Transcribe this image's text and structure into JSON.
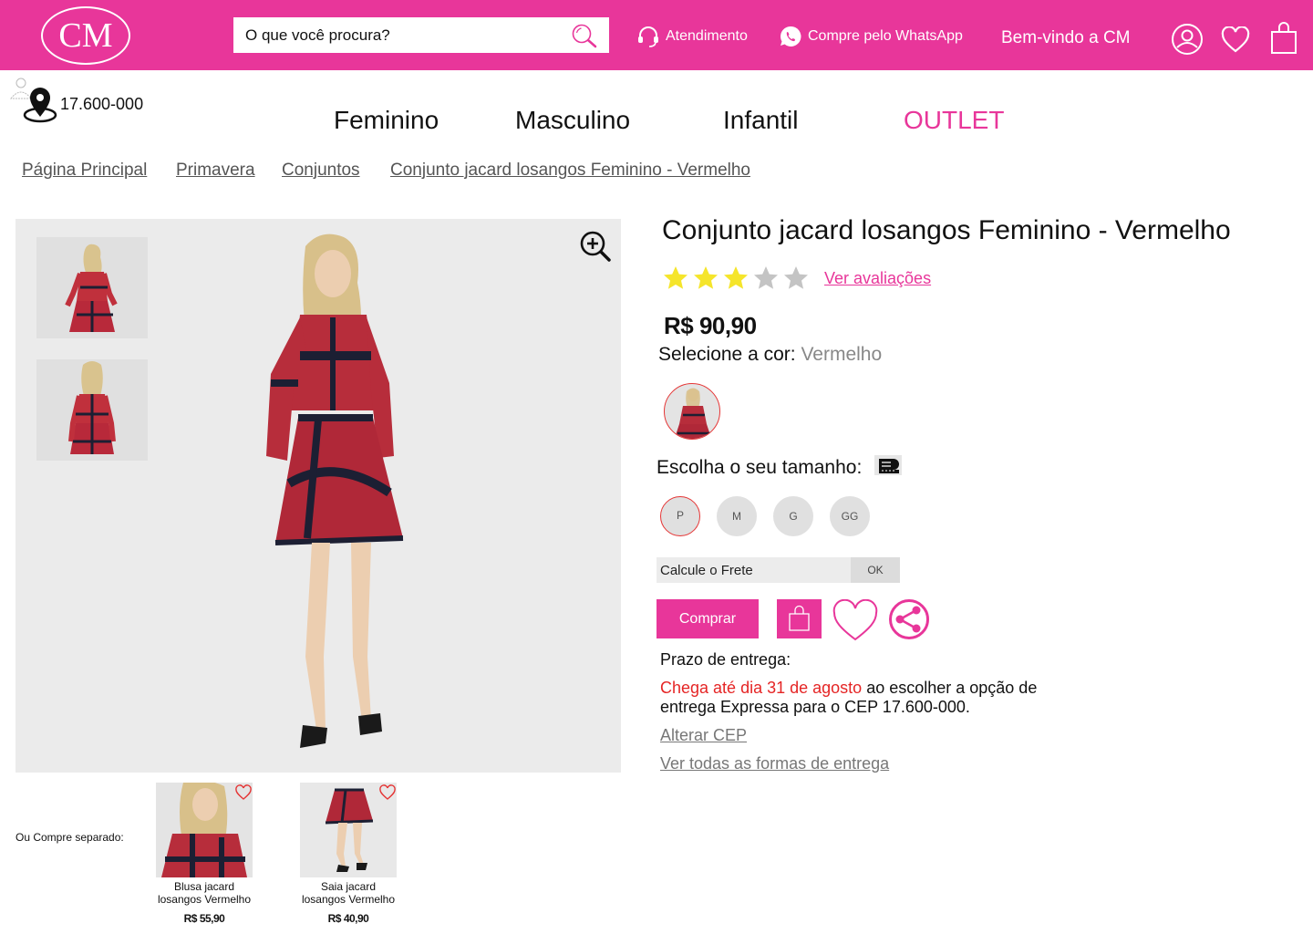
{
  "brand": {
    "logo_text": "CM",
    "accent_color": "#e8369a"
  },
  "header": {
    "search_placeholder": "O que você procura?",
    "support_label": "Atendimento",
    "whatsapp_label": "Compre pelo WhatsApp",
    "welcome_text": "Bem-vindo a CM",
    "icons": [
      "search-icon",
      "headset-icon",
      "whatsapp-icon",
      "user-icon",
      "heart-icon",
      "shopping-bag-icon"
    ]
  },
  "location": {
    "cep": "17.600-000",
    "icon": "map-pin-icon"
  },
  "nav": {
    "items": [
      "Feminino",
      "Masculino",
      "Infantil",
      "OUTLET"
    ]
  },
  "breadcrumb": [
    "Página Principal",
    "Primavera",
    "Conjuntos",
    "Conjunto jacard losangos Feminino - Vermelho"
  ],
  "product": {
    "title": "Conjunto jacard losangos Feminino - Vermelho",
    "rating": 3,
    "rating_max": 5,
    "reviews_link": "Ver avaliações",
    "price": "R$ 90,90",
    "color_label": "Selecione a cor:",
    "color_value": "Vermelho",
    "size_label": "Escolha o seu tamanho:",
    "sizes": [
      "P",
      "M",
      "G",
      "GG"
    ],
    "selected_size": "P",
    "freight_placeholder": "Calcule o Frete",
    "freight_button": "OK",
    "buy_button": "Comprar"
  },
  "delivery": {
    "label": "Prazo de entrega:",
    "highlight": "Chega até dia 31 de agosto",
    "rest": " ao escolher a opção de entrega Expressa para o CEP 17.600-000.",
    "change_cep": "Alterar CEP ",
    "all_options": "Ver todas as formas de entrega"
  },
  "separately": {
    "label": "Ou Compre separado:",
    "items": [
      {
        "name": "Blusa jacard losangos Vermelho",
        "price": "R$ 55,90"
      },
      {
        "name": "Saia jacard losangos Vermelho",
        "price": "R$ 40,90"
      }
    ]
  }
}
